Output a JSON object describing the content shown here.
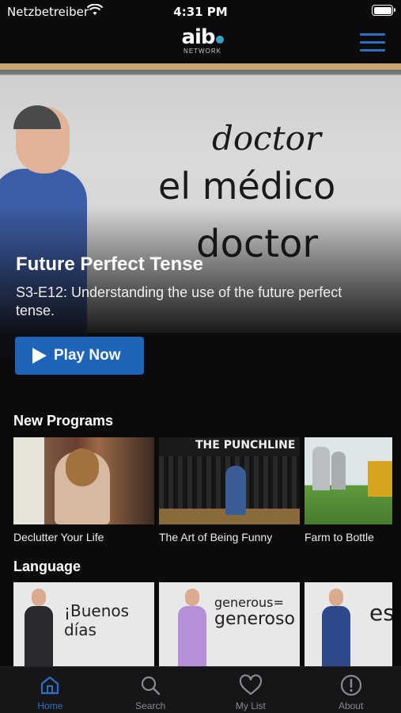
{
  "status_bar": {
    "carrier": "Netzbetreiber",
    "time": "4:31 PM"
  },
  "header": {
    "logo_text": "aib",
    "logo_subtext": "NETWORK"
  },
  "hero": {
    "board_words": [
      "doctor",
      "el médico",
      "doctor"
    ],
    "title": "Future Perfect Tense",
    "description": "S3-E12: Understanding the use of the future perfect tense.",
    "play_label": "Play Now",
    "accent_color": "#1e64b8"
  },
  "sections": {
    "new_programs": {
      "title": "New Programs",
      "items": [
        {
          "caption": "Declutter Your Life"
        },
        {
          "caption": "The Art of Being Funny",
          "thumb_text": "THE PUNCHLINE"
        },
        {
          "caption": "Farm to Bottle"
        }
      ]
    },
    "language": {
      "title": "Language",
      "items": [
        {
          "board_text": "¡Buenos días"
        },
        {
          "board_text_top": "generous=",
          "board_text_bottom": "generoso"
        },
        {
          "board_text": "es"
        }
      ]
    }
  },
  "tab_bar": {
    "items": [
      {
        "label": "Home",
        "icon": "home-icon",
        "active": true
      },
      {
        "label": "Search",
        "icon": "search-icon"
      },
      {
        "label": "My List",
        "icon": "heart-icon"
      },
      {
        "label": "About",
        "icon": "info-icon"
      }
    ],
    "active_color": "#2f6fc1"
  }
}
